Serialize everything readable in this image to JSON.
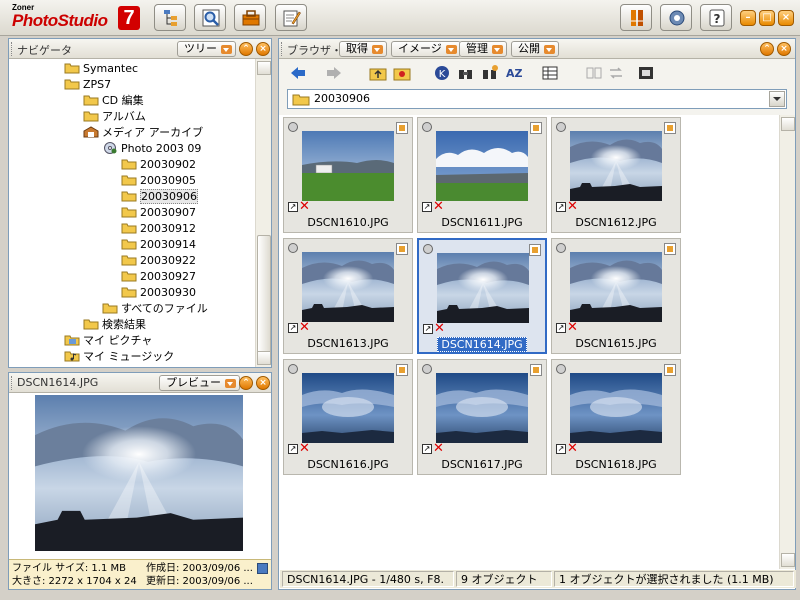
{
  "app": {
    "brand_small": "Zoner",
    "brand_main": "PhotoStudio",
    "brand_version": "7"
  },
  "navigator": {
    "title": "ナビゲータ",
    "view_dropdown": "ツリー",
    "tree": [
      {
        "label": "Symantec",
        "level": 3,
        "icon": "folder-icon"
      },
      {
        "label": "ZPS7",
        "level": 3,
        "icon": "folder-icon"
      },
      {
        "label": "CD 編集",
        "level": 4,
        "icon": "folder-icon"
      },
      {
        "label": "アルバム",
        "level": 4,
        "icon": "folder-icon"
      },
      {
        "label": "メディア アーカイブ",
        "level": 4,
        "icon": "archive-icon"
      },
      {
        "label": "Photo 2003 09",
        "level": 5,
        "icon": "disc-icon"
      },
      {
        "label": "20030902",
        "level": 6,
        "icon": "folder-icon"
      },
      {
        "label": "20030905",
        "level": 6,
        "icon": "folder-icon"
      },
      {
        "label": "20030906",
        "level": 6,
        "icon": "folder-icon",
        "selected": true
      },
      {
        "label": "20030907",
        "level": 6,
        "icon": "folder-icon"
      },
      {
        "label": "20030912",
        "level": 6,
        "icon": "folder-icon"
      },
      {
        "label": "20030914",
        "level": 6,
        "icon": "folder-icon"
      },
      {
        "label": "20030922",
        "level": 6,
        "icon": "folder-icon"
      },
      {
        "label": "20030927",
        "level": 6,
        "icon": "folder-icon"
      },
      {
        "label": "20030930",
        "level": 6,
        "icon": "folder-icon"
      },
      {
        "label": "すべてのファイル",
        "level": 5,
        "icon": "folder-icon"
      },
      {
        "label": "検索結果",
        "level": 4,
        "icon": "folder-icon"
      },
      {
        "label": "マイ ピクチャ",
        "level": 3,
        "icon": "pictures-icon"
      },
      {
        "label": "マイ ミュージック",
        "level": 3,
        "icon": "music-icon"
      }
    ]
  },
  "preview": {
    "title": "DSCN1614.JPG",
    "mode_dropdown": "プレビュー",
    "info": {
      "filesize": "ファイル サイズ: 1.1 MB",
      "created": "作成日: 2003/09/06 ...",
      "dimensions": "大きさ: 2272 x 1704 x 24",
      "modified": "更新日: 2003/09/06 ..."
    }
  },
  "browser": {
    "tab_label": "ブラウザ・",
    "menus": [
      "取得",
      "イメージ",
      "管理",
      "公開"
    ],
    "path": "20030906",
    "thumbnails": [
      {
        "name": "DSCN1610.JPG",
        "scene": "field"
      },
      {
        "name": "DSCN1611.JPG",
        "scene": "cloudline"
      },
      {
        "name": "DSCN1612.JPG",
        "scene": "sunrays"
      },
      {
        "name": "DSCN1613.JPG",
        "scene": "sunrays"
      },
      {
        "name": "DSCN1614.JPG",
        "scene": "sunrays",
        "selected": true
      },
      {
        "name": "DSCN1615.JPG",
        "scene": "sunrays"
      },
      {
        "name": "DSCN1616.JPG",
        "scene": "bluerays"
      },
      {
        "name": "DSCN1617.JPG",
        "scene": "bluerays"
      },
      {
        "name": "DSCN1618.JPG",
        "scene": "bluerays"
      }
    ]
  },
  "status": {
    "file_info": "DSCN1614.JPG - 1/480 s, F8.",
    "object_count": "9 オブジェクト",
    "selection": "1 オブジェクトが選択されました (1.1 MB)"
  },
  "colors": {
    "selection": "#316ac5",
    "accent": "#e68a2e",
    "panel_border": "#7f9db9"
  }
}
